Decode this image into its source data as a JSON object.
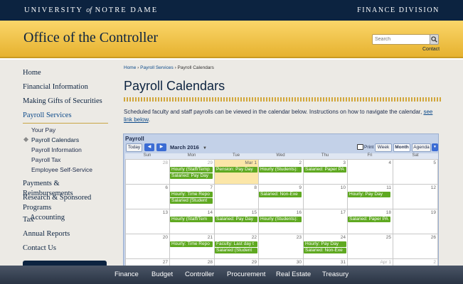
{
  "topbar": {
    "university_pre": "UNIVERSITY",
    "university_of": "of",
    "university_post": "NOTRE DAME",
    "division": "FINANCE DIVISION"
  },
  "banner": {
    "title": "Office of the Controller",
    "search_placeholder": "Search",
    "contact": "Contact"
  },
  "sidebar": {
    "home": "Home",
    "financial_information": "Financial Information",
    "making_gifts": "Making Gifts of Securities",
    "payroll_services": "Payroll Services",
    "your_pay": "Your Pay",
    "payroll_calendars": "Payroll Calendars",
    "payroll_information": "Payroll Information",
    "payroll_tax": "Payroll Tax",
    "employee_self_service": "Employee Self-Service",
    "payments": "Payments & Reimbursements",
    "research_line1": "Research & Sponsored Programs",
    "research_line2": "Accounting",
    "tax": "Tax",
    "annual_reports": "Annual Reports",
    "contact_us": "Contact Us"
  },
  "breadcrumb": {
    "home": "Home",
    "sep": "›",
    "payroll_services": "Payroll Services",
    "current": "Payroll Calendars"
  },
  "page": {
    "heading": "Payroll Calendars",
    "intro": "Scheduled faculty and staff payrolls  can be viewed in the calendar below. Instructions on how to navigate the calendar, ",
    "intro_link": "see link below",
    "intro_end": "."
  },
  "calendar": {
    "title": "Payroll",
    "today": "Today",
    "prev": "◀",
    "next": "▶",
    "month": "March 2016",
    "print": "Print",
    "views": [
      "Week",
      "Month",
      "Agenda"
    ],
    "weekdays": [
      "Sun",
      "Mon",
      "Tue",
      "Wed",
      "Thu",
      "Fri",
      "Sat"
    ],
    "weeks": [
      [
        "28",
        "29",
        "Mar 1",
        "2",
        "3",
        "4",
        "5"
      ],
      [
        "6",
        "7",
        "8",
        "9",
        "10",
        "11",
        "12"
      ],
      [
        "13",
        "14",
        "15",
        "16",
        "17",
        "18",
        "19"
      ],
      [
        "20",
        "21",
        "22",
        "23",
        "24",
        "25",
        "26"
      ],
      [
        "27",
        "28",
        "29",
        "30",
        "31",
        "Apr 1",
        "2"
      ]
    ],
    "events": {
      "w0_mon_1": "Hourly (Staff/Temp",
      "w0_mon_2": "Salaried: Pay Day",
      "w0_tue_1": "Pension: Pay Day",
      "w0_wed_1": "Hourly (Students):",
      "w0_thu_1": "Salaried: Paper PA",
      "w1_mon_1": "Hourly: Time Repo",
      "w1_mon_2": "Salaried (Student",
      "w1_wed_1": "Salaried: Non-Exe",
      "w1_fri_1": "Hourly: Pay Day",
      "w2_mon_1": "Hourly (Staff/Tem",
      "w2_tue_1": "Salaried: Pay Day",
      "w2_wed_1": "Hourly (Students):",
      "w2_fri_1": "Salaried: Paper PA",
      "w3_mon_1": "Hourly: Time Repo",
      "w3_tue_1": "Faculty: Last day t",
      "w3_tue_2": "Salaried (Student",
      "w3_thu_1": "Hourly: Pay Day",
      "w3_thu_2": "Salaried: Non-Exe"
    }
  },
  "footer": {
    "items": [
      "Finance",
      "Budget",
      "Controller",
      "Procurement",
      "Real Estate",
      "Treasury"
    ]
  }
}
